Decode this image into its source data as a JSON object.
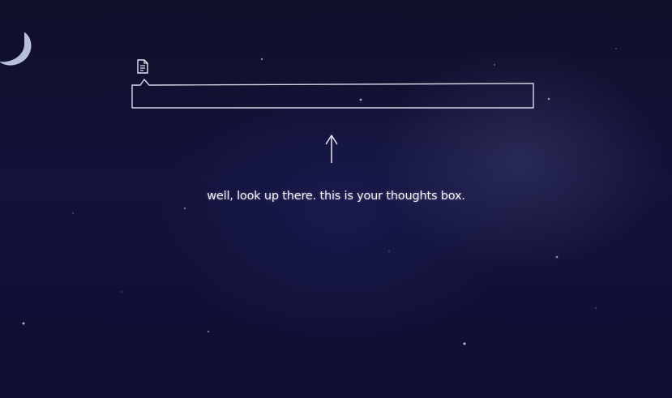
{
  "background": {
    "colors": {
      "sky": "#12123a",
      "glow": "#3c3c6e",
      "line": "#d8d8e8"
    },
    "icons": [
      "crescent-moon-icon",
      "star-icon"
    ]
  },
  "thoughts_box": {
    "icon": "note-icon",
    "value": "",
    "placeholder": ""
  },
  "hint": {
    "arrow_icon": "arrow-up-icon",
    "text": "well, look up there. this is your thoughts box."
  }
}
